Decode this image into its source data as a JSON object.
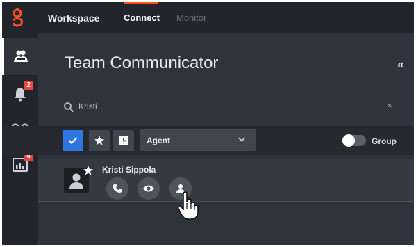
{
  "topnav": {
    "app_name": "Workspace",
    "tabs": [
      {
        "label": "Connect",
        "active": true
      },
      {
        "label": "Monitor",
        "active": false
      }
    ]
  },
  "rail": {
    "items": [
      {
        "name": "team-communicator",
        "icon": "contacts-icon",
        "active": true
      },
      {
        "name": "notifications",
        "icon": "bell-icon",
        "badge": "2"
      },
      {
        "name": "voicemail",
        "icon": "voicemail-icon"
      },
      {
        "name": "reports",
        "icon": "chart-icon",
        "badge": "4"
      }
    ]
  },
  "panel": {
    "title": "Team Communicator",
    "collapse_label": "«"
  },
  "search": {
    "value": "Kristi",
    "clear_label": "×"
  },
  "filters": {
    "buttons": [
      {
        "name": "all",
        "icon": "check-icon",
        "selected": true
      },
      {
        "name": "favorites",
        "icon": "star-icon",
        "selected": false
      },
      {
        "name": "recent",
        "icon": "clock-icon",
        "selected": false
      }
    ],
    "type_value": "Agent",
    "group_label": "Group",
    "group_toggle_on": false
  },
  "results": [
    {
      "name": "Kristi Sippola",
      "favorite": true,
      "actions": [
        "phone-icon",
        "monitor-eye-icon",
        "person-icon"
      ]
    }
  ],
  "colors": {
    "accent": "#2f78e3",
    "brand": "#ff4f1f",
    "badge": "#e8453c"
  }
}
